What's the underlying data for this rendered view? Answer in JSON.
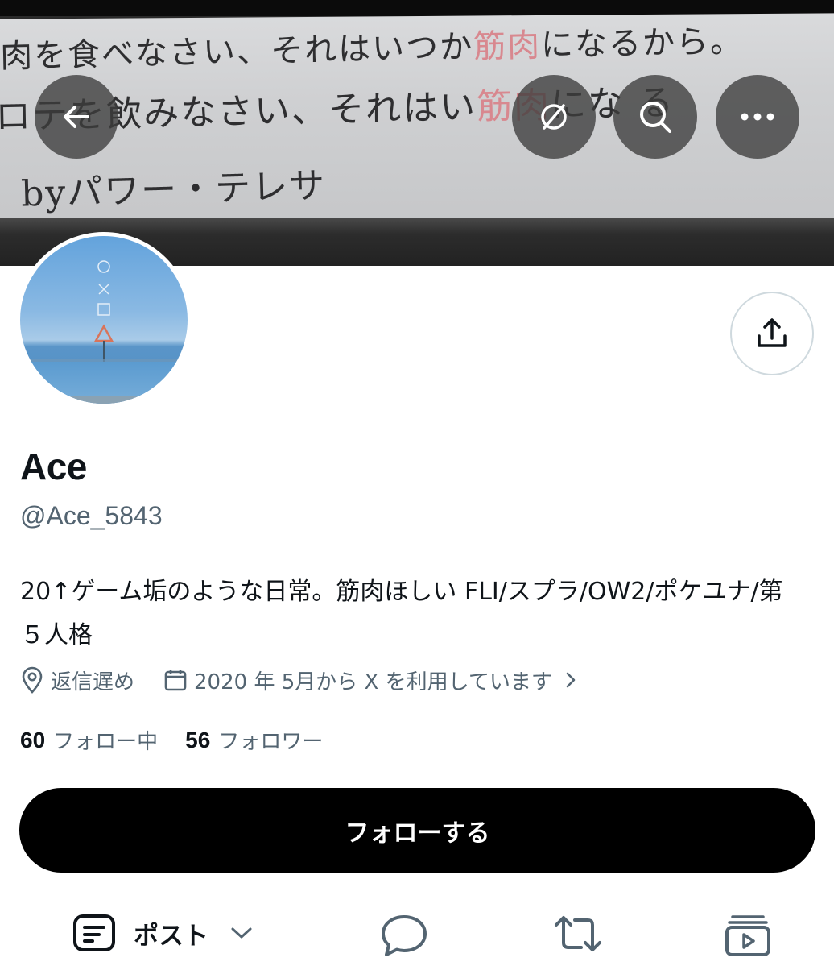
{
  "banner": {
    "quote_line1": "肉を食べなさい、それはいつか",
    "quote_line1_highlight": "筋肉",
    "quote_line1_end": "になるから。",
    "quote_line2": "ロテ",
    "quote_line2_rest": "を飲みなさい、それはい",
    "quote_line2_highlight": "筋肉",
    "quote_line2_end": "にな る",
    "quote_line3": "。byパワー・テレサ"
  },
  "profile": {
    "name": "Ace",
    "handle": "@Ace_5843",
    "bio": "20↑ゲーム垢のような日常。筋肉ほしい FLI/スプラ/OW2/ポケユナ/第５人格",
    "location": "返信遅め",
    "joined": "2020 年 5月から X を利用しています",
    "following_count": "60",
    "following_label": "フォロー中",
    "followers_count": "56",
    "followers_label": "フォロワー"
  },
  "actions": {
    "follow_label": "フォローする"
  },
  "tabs": {
    "posts_label": "ポスト"
  },
  "icons": {
    "back": "arrow-left-icon",
    "hide": "eye-off-icon",
    "search": "search-icon",
    "more": "more-icon",
    "share": "share-icon",
    "location": "location-pin-icon",
    "calendar": "calendar-icon"
  },
  "colors": {
    "text": "#0f1419",
    "secondary_text": "#536471",
    "follow_button": "#000000",
    "quote_highlight": "#d8888f"
  }
}
